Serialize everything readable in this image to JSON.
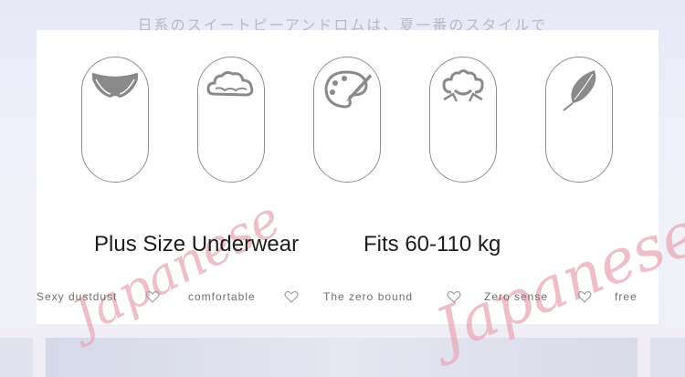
{
  "banner": {
    "top_text": "日系のスイートピーアンドロムは、夏一番のスタイルで"
  },
  "icons": [
    "panties-icon",
    "cloud-icon",
    "palette-icon",
    "cotton-icon",
    "leaf-icon"
  ],
  "headline": {
    "product": "Plus Size Underwear",
    "fit": "Fits 60-110 kg"
  },
  "features": [
    "Sexy dustdust",
    "comfortable",
    "The zero bound",
    "Zero sense",
    "free"
  ],
  "watermarks": [
    "Japanese",
    "Japanese"
  ],
  "colors": {
    "icon_gray": "#8a8a8a",
    "outline": "#8f8f8f",
    "watermark_pink": "#e9a9b8"
  }
}
